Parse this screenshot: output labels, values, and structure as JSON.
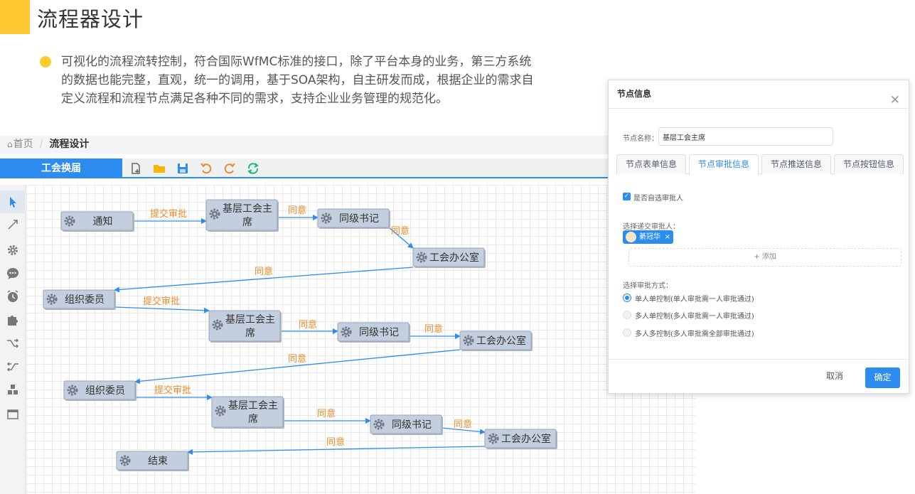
{
  "page": {
    "title": "流程器设计",
    "intro_lines": [
      "可视化的流程流转控制，符合国际WfMC标准的接口，除了平台本身的业务，第三方系统",
      "的数据也能完整，直观，统一的调用，基于SOA架构，自主研发而成，根据企业的需求自",
      "定义流程和流程节点满足各种不同的需求，支持企业业务管理的规范化。"
    ],
    "accent_color": "#ffc933"
  },
  "breadcrumb": {
    "home": "首页",
    "current": "流程设计"
  },
  "toolbar": {
    "tab_label": "工会换届",
    "tools": [
      "new-file-icon",
      "open-folder-icon",
      "save-icon",
      "undo-icon",
      "redo-icon",
      "refresh-icon"
    ]
  },
  "left_tools": [
    "pointer-icon",
    "line-icon",
    "gear-icon",
    "chat-icon",
    "clock-icon",
    "puzzle-icon",
    "split-icon",
    "merge-icon",
    "cubes-icon",
    "panel-icon"
  ],
  "flow": {
    "node_fill": "#c3cede",
    "edge_color": "#2d8cf0",
    "edge_label_color": "#f08a28",
    "nodes": [
      {
        "id": "n1",
        "lines": [
          "通知"
        ]
      },
      {
        "id": "n2",
        "lines": [
          "基层工会主",
          "席"
        ]
      },
      {
        "id": "n3",
        "lines": [
          "同级书记"
        ]
      },
      {
        "id": "n4",
        "lines": [
          "工会办公室"
        ]
      },
      {
        "id": "n5",
        "lines": [
          "组织委员"
        ]
      },
      {
        "id": "n6",
        "lines": [
          "基层工会主",
          "席"
        ]
      },
      {
        "id": "n7",
        "lines": [
          "同级书记"
        ]
      },
      {
        "id": "n8",
        "lines": [
          "工会办公室"
        ]
      },
      {
        "id": "n9",
        "lines": [
          "组织委员"
        ]
      },
      {
        "id": "n10",
        "lines": [
          "基层工会主",
          "席"
        ]
      },
      {
        "id": "n11",
        "lines": [
          "同级书记"
        ]
      },
      {
        "id": "n12",
        "lines": [
          "工会办公室"
        ]
      },
      {
        "id": "n13",
        "lines": [
          "结束"
        ]
      }
    ],
    "edges": [
      {
        "id": "e1",
        "label": "提交审批"
      },
      {
        "id": "e2",
        "label": "同意"
      },
      {
        "id": "e3",
        "label": "同意"
      },
      {
        "id": "e4",
        "label": "同意"
      },
      {
        "id": "e5",
        "label": "提交审批"
      },
      {
        "id": "e6",
        "label": "同意"
      },
      {
        "id": "e7",
        "label": "同意"
      },
      {
        "id": "e8",
        "label": "同意"
      },
      {
        "id": "e9",
        "label": "提交审批"
      },
      {
        "id": "e10",
        "label": "同意"
      },
      {
        "id": "e11",
        "label": "同意"
      },
      {
        "id": "e12",
        "label": "同意"
      }
    ]
  },
  "dialog": {
    "title": "节点信息",
    "name_label": "节点名称：",
    "name_value": "基层工会主席",
    "tabs": [
      {
        "label": "节点表单信息",
        "active": false
      },
      {
        "label": "节点审批信息",
        "active": true
      },
      {
        "label": "节点推送信息",
        "active": false
      },
      {
        "label": "节点按钮信息",
        "active": false
      }
    ],
    "checkbox_label": "是否自选审批人",
    "checkbox_checked": true,
    "approver_label": "选择递交审批人：",
    "approver_name": "綦冠华",
    "add_label": "+ 添加",
    "mode_label": "选择审批方式：",
    "modes": [
      {
        "label": "单人单控制(单人审批需一人审批通过)",
        "selected": true
      },
      {
        "label": "多人单控制(多人审批需一人审批通过)",
        "selected": false
      },
      {
        "label": "多人多控制(多人审批需全部审批通过)",
        "selected": false
      }
    ],
    "cancel_label": "取消",
    "ok_label": "确定",
    "primary_color": "#2d8cf0"
  }
}
